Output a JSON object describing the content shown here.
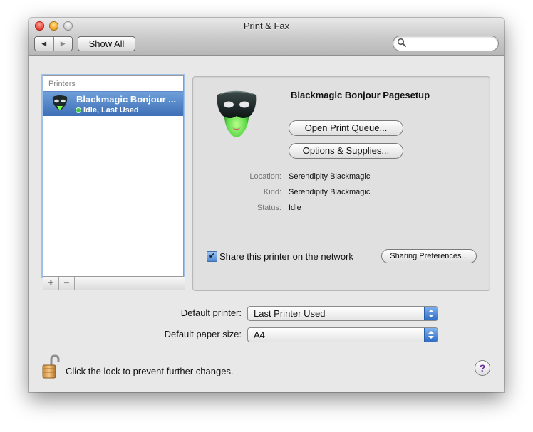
{
  "window": {
    "title": "Print & Fax",
    "show_all_label": "Show All",
    "search_placeholder": "",
    "nav_back": "◀",
    "nav_forward": "▶"
  },
  "printers": {
    "header": "Printers",
    "items": [
      {
        "name": "Blackmagic Bonjour ...",
        "status": "Idle, Last Used",
        "icon": "mask-printer-icon"
      }
    ],
    "add_label": "+",
    "remove_label": "−"
  },
  "detail": {
    "title": "Blackmagic Bonjour Pagesetup",
    "open_queue_label": "Open Print Queue...",
    "options_label": "Options & Supplies...",
    "location_label": "Location:",
    "location_value": "Serendipity Blackmagic",
    "kind_label": "Kind:",
    "kind_value": "Serendipity Blackmagic",
    "status_label": "Status:",
    "status_value": "Idle",
    "share_checked": true,
    "share_check_glyph": "✔",
    "share_label": "Share this printer on the network",
    "sharing_prefs_label": "Sharing Preferences..."
  },
  "defaults": {
    "printer_label": "Default printer:",
    "printer_value": "Last Printer Used",
    "paper_label": "Default paper size:",
    "paper_value": "A4"
  },
  "footer": {
    "lock_text": "Click the lock to prevent further changes.",
    "help_label": "?"
  },
  "colors": {
    "selection": "#3e6fb7",
    "window_bg": "#e8e8e8",
    "popup_arrow": "#2f6cc6",
    "status_idle": "#41c34a"
  }
}
